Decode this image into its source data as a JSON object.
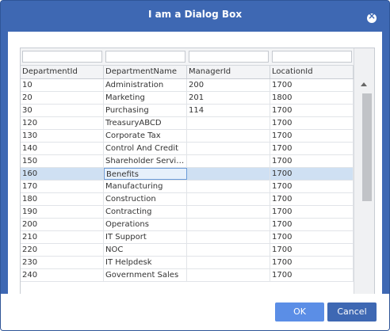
{
  "dialog": {
    "title": "I am a Dialog Box",
    "ok_label": "OK",
    "cancel_label": "Cancel"
  },
  "grid": {
    "columns": [
      "DepartmentId",
      "DepartmentName",
      "ManagerId",
      "LocationId"
    ],
    "selected_row_index": 9,
    "rows": [
      [
        "10",
        "Administration",
        "200",
        "1700"
      ],
      [
        "20",
        "Marketing",
        "201",
        "1800"
      ],
      [
        "30",
        "Purchasing",
        "114",
        "1700"
      ],
      [
        "120",
        "TreasuryABCD",
        "",
        "1700"
      ],
      [
        "130",
        "Corporate Tax",
        "",
        "1700"
      ],
      [
        "140",
        "Control And Credit",
        "",
        "1700"
      ],
      [
        "150",
        "Shareholder Servic...",
        "",
        "1700"
      ],
      [
        "160",
        "Benefits",
        "",
        "1700"
      ],
      [
        "170",
        "Manufacturing",
        "",
        "1700"
      ],
      [
        "180",
        "Construction",
        "",
        "1700"
      ],
      [
        "190",
        "Contracting",
        "",
        "1700"
      ],
      [
        "200",
        "Operations",
        "",
        "1700"
      ],
      [
        "210",
        "IT Support",
        "",
        "1700"
      ],
      [
        "220",
        "NOC",
        "",
        "1700"
      ],
      [
        "230",
        "IT Helpdesk",
        "",
        "1700"
      ],
      [
        "240",
        "Government Sales",
        "",
        "1700"
      ]
    ]
  },
  "icons": {
    "close": "close-icon",
    "scroll_up": "scroll-up-icon",
    "scroll_down": "scroll-down-icon"
  },
  "colors": {
    "titlebar": "#3e68b3",
    "ok_button": "#5b8ee6",
    "cancel_button": "#3e68b3",
    "selected_row": "#cfe0f3"
  }
}
